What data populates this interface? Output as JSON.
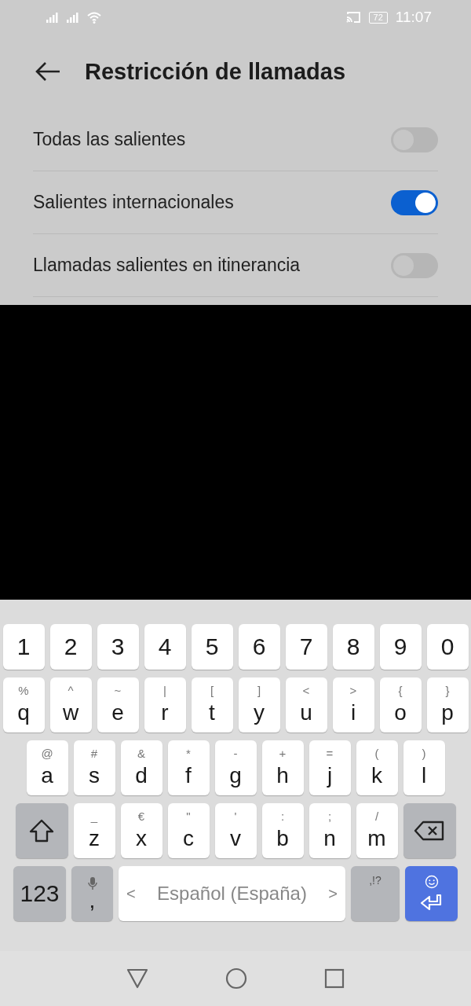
{
  "status_bar": {
    "battery": "72",
    "time": "11:07"
  },
  "header": {
    "title": "Restricción de llamadas"
  },
  "settings": [
    {
      "label": "Todas las salientes",
      "on": false
    },
    {
      "label": "Salientes internacionales",
      "on": true
    },
    {
      "label": "Llamadas salientes en itinerancia",
      "on": false
    }
  ],
  "keyboard": {
    "digits": [
      "1",
      "2",
      "3",
      "4",
      "5",
      "6",
      "7",
      "8",
      "9",
      "0"
    ],
    "row_1": [
      {
        "key": "q",
        "hint": "%"
      },
      {
        "key": "w",
        "hint": "^"
      },
      {
        "key": "e",
        "hint": "~"
      },
      {
        "key": "r",
        "hint": "|"
      },
      {
        "key": "t",
        "hint": "["
      },
      {
        "key": "y",
        "hint": "]"
      },
      {
        "key": "u",
        "hint": "<"
      },
      {
        "key": "i",
        "hint": ">"
      },
      {
        "key": "o",
        "hint": "{"
      },
      {
        "key": "p",
        "hint": "}"
      }
    ],
    "row_2": [
      {
        "key": "a",
        "hint": "@"
      },
      {
        "key": "s",
        "hint": "#"
      },
      {
        "key": "d",
        "hint": "&"
      },
      {
        "key": "f",
        "hint": "*"
      },
      {
        "key": "g",
        "hint": "-"
      },
      {
        "key": "h",
        "hint": "+"
      },
      {
        "key": "j",
        "hint": "="
      },
      {
        "key": "k",
        "hint": "("
      },
      {
        "key": "l",
        "hint": ")"
      }
    ],
    "row_3": [
      {
        "key": "z",
        "hint": "_"
      },
      {
        "key": "x",
        "hint": "€"
      },
      {
        "key": "c",
        "hint": "\""
      },
      {
        "key": "v",
        "hint": "'"
      },
      {
        "key": "b",
        "hint": ":"
      },
      {
        "key": "n",
        "hint": ";"
      },
      {
        "key": "m",
        "hint": "/"
      }
    ],
    "symbols_key": "123",
    "comma_key": ",",
    "space_key": "Español (España)",
    "space_prev": "<",
    "space_next": ">",
    "punctuation_key": ",!?"
  }
}
